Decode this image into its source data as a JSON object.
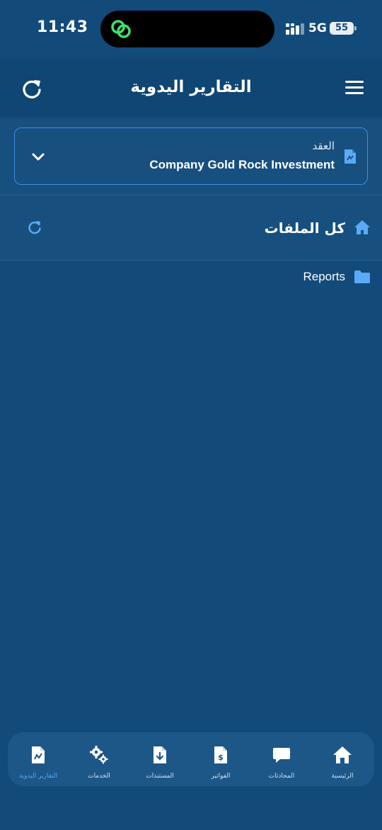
{
  "status": {
    "time": "11:43",
    "network": "5G",
    "battery": "55"
  },
  "header": {
    "title": "التقارير اليدوية"
  },
  "contract": {
    "label": "العقد",
    "value": "Company Gold Rock Investment"
  },
  "breadcrumb": {
    "label": "كل الملفات"
  },
  "files": [
    {
      "name": "Reports",
      "icon": "folder-icon"
    }
  ],
  "nav": {
    "items": [
      {
        "label": "الرئيسية",
        "icon": "home-icon"
      },
      {
        "label": "المحادثات",
        "icon": "chat-icon"
      },
      {
        "label": "الفواتير",
        "icon": "invoice-icon"
      },
      {
        "label": "المستندات",
        "icon": "document-download-icon"
      },
      {
        "label": "الخدمات",
        "icon": "gears-icon"
      },
      {
        "label": "التقارير اليدوية",
        "icon": "report-icon"
      }
    ],
    "active_index": 5
  },
  "colors": {
    "background": "#124a7a",
    "accent": "#3d8fe0",
    "active": "#53a7ff"
  }
}
